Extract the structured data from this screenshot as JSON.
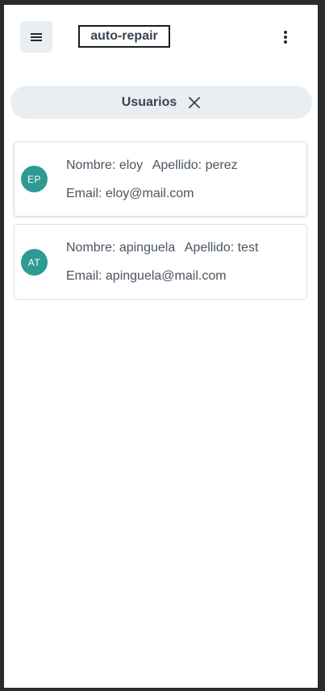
{
  "header": {
    "brand": "auto-repair"
  },
  "filter_chip": {
    "label": "Usuarios"
  },
  "users": [
    {
      "initials": "EP",
      "nombre_label": "Nombre:",
      "nombre": "eloy",
      "apellido_label": "Apellido:",
      "apellido": "perez",
      "email_label": "Email:",
      "email": "eloy@mail.com"
    },
    {
      "initials": "AT",
      "nombre_label": "Nombre:",
      "nombre": "apinguela",
      "apellido_label": "Apellido:",
      "apellido": "test",
      "email_label": "Email:",
      "email": "apinguela@mail.com"
    }
  ],
  "icons": {
    "menu": "hamburger-menu-icon",
    "more": "more-vertical-icon",
    "close": "close-icon"
  },
  "colors": {
    "avatar": "#2e9b92",
    "chip_background": "#e9eef2",
    "text": "#4a5561"
  }
}
